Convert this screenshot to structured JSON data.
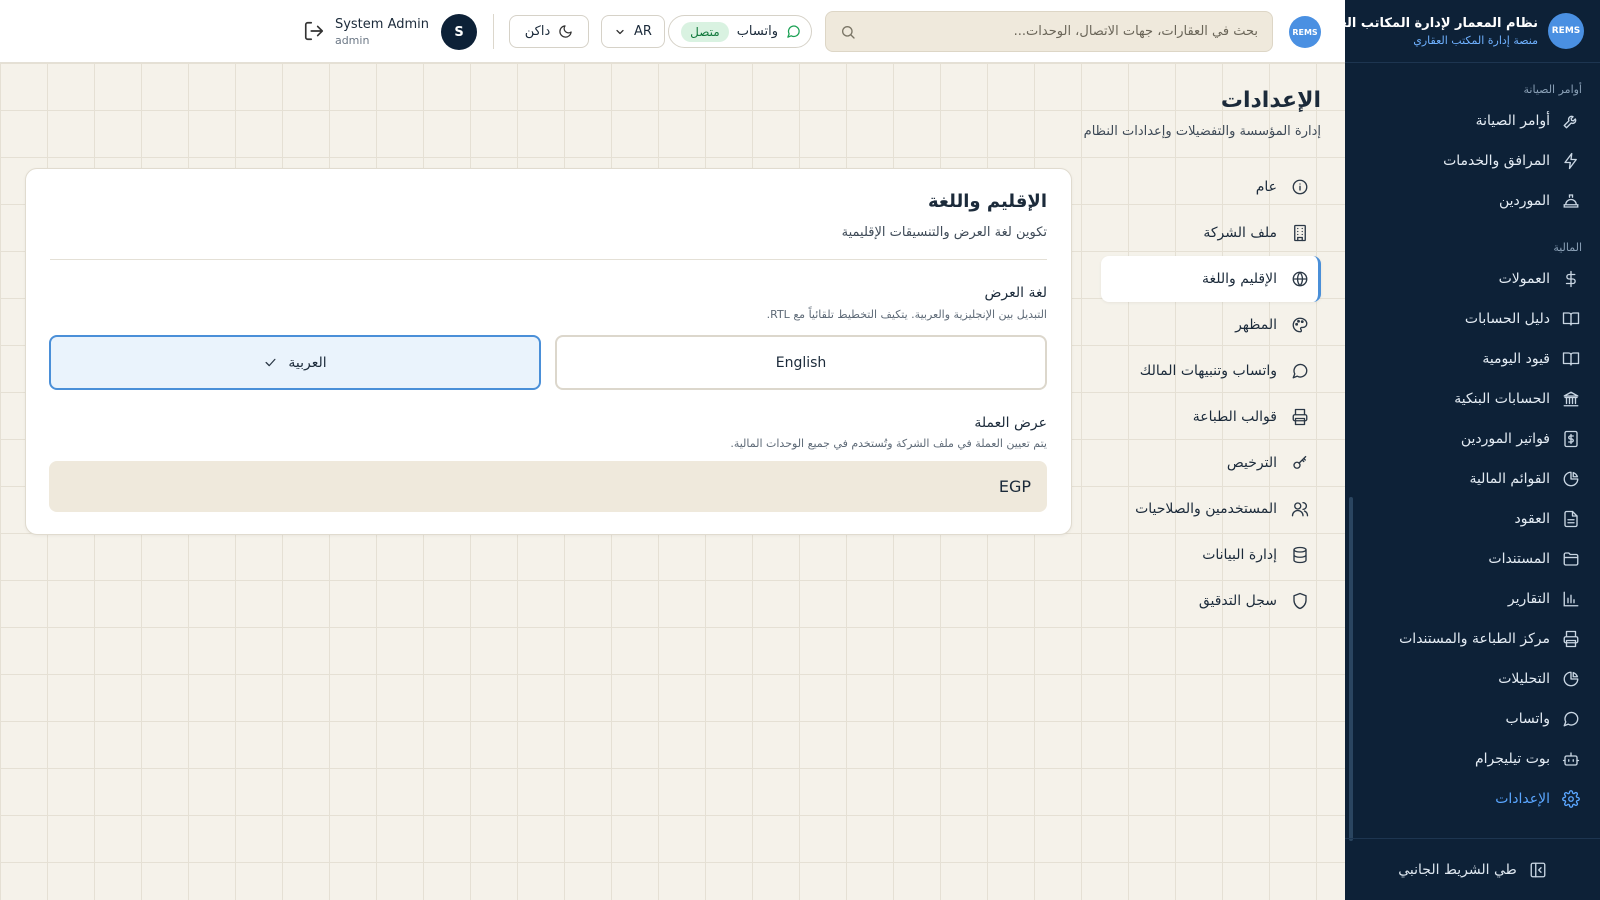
{
  "brand": {
    "logo": "REMS",
    "title": "نظام المعمار لإدارة المكاتب العقارية",
    "subtitle": "منصة إدارة المكتب العقاري"
  },
  "sidebar": {
    "sections": [
      {
        "label": "أوامر الصيانة",
        "items": [
          {
            "label": "أوامر الصيانة",
            "icon": "wrench-icon"
          },
          {
            "label": "المرافق والخدمات",
            "icon": "lightning-icon"
          },
          {
            "label": "الموردين",
            "icon": "hardhat-icon"
          }
        ]
      },
      {
        "label": "المالية",
        "items": [
          {
            "label": "العمولات",
            "icon": "dollar-icon"
          },
          {
            "label": "دليل الحسابات",
            "icon": "book-icon"
          },
          {
            "label": "قيود اليومية",
            "icon": "book-icon"
          },
          {
            "label": "الحسابات البنكية",
            "icon": "bank-icon"
          },
          {
            "label": "فواتير الموردين",
            "icon": "invoice-icon"
          },
          {
            "label": "القوائم المالية",
            "icon": "piechart-icon"
          },
          {
            "label": "العقود",
            "icon": "document-icon"
          },
          {
            "label": "المستندات",
            "icon": "folder-icon"
          },
          {
            "label": "التقارير",
            "icon": "barchart-icon"
          },
          {
            "label": "مركز الطباعة والمستندات",
            "icon": "printer-icon"
          },
          {
            "label": "التحليلات",
            "icon": "piechart-icon"
          },
          {
            "label": "واتساب",
            "icon": "chat-icon"
          },
          {
            "label": "بوت تيليجرام",
            "icon": "bot-icon"
          },
          {
            "label": "الإعدادات",
            "icon": "gear-icon",
            "active": true
          }
        ]
      }
    ],
    "collapse_label": "طي الشريط الجانبي"
  },
  "topbar": {
    "search_placeholder": "بحث في العقارات، جهات الاتصال، الوحدات...",
    "whatsapp_label": "واتساب",
    "whatsapp_status": "متصل",
    "language_label": "AR",
    "theme_label": "داكن",
    "user_name": "System Admin",
    "user_role": "admin",
    "user_initial": "S"
  },
  "page": {
    "title": "الإعدادات",
    "subtitle": "إدارة المؤسسة والتفضيلات وإعدادات النظام"
  },
  "settings_nav": [
    {
      "label": "عام",
      "icon": "info-icon"
    },
    {
      "label": "ملف الشركة",
      "icon": "building-icon"
    },
    {
      "label": "الإقليم واللغة",
      "icon": "globe-icon",
      "active": true
    },
    {
      "label": "المظهر",
      "icon": "palette-icon"
    },
    {
      "label": "واتساب وتنبيهات المالك",
      "icon": "chat-icon"
    },
    {
      "label": "قوالب الطباعة",
      "icon": "printer-icon"
    },
    {
      "label": "الترخيص",
      "icon": "key-icon"
    },
    {
      "label": "المستخدمين والصلاحيات",
      "icon": "users-icon"
    },
    {
      "label": "إدارة البيانات",
      "icon": "database-icon"
    },
    {
      "label": "سجل التدقيق",
      "icon": "shield-icon"
    }
  ],
  "card": {
    "title": "الإقليم واللغة",
    "subtitle": "تكوين لغة العرض والتنسيقات الإقليمية",
    "display_language_label": "لغة العرض",
    "display_language_hint": "التبديل بين الإنجليزية والعربية. يتكيف التخطيط تلقائياً مع RTL.",
    "option_english": "English",
    "option_arabic": "العربية",
    "selected_language": "العربية",
    "currency_label": "عرض العملة",
    "currency_hint": "يتم تعيين العملة في ملف الشركة وتُستخدم في جميع الوحدات المالية.",
    "currency_value": "EGP"
  },
  "colors": {
    "sidebar_bg": "#0d2137",
    "accent": "#4a8fd8",
    "status_green": "#12793c",
    "page_bg": "#f5f2ea"
  }
}
